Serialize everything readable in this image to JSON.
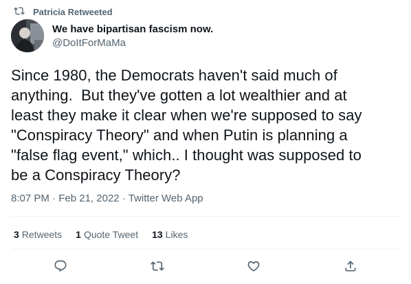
{
  "retweet_notice": {
    "text": "Patricia Retweeted",
    "icon": "retweet-icon"
  },
  "author": {
    "display_name": "We have bipartisan fascism now.",
    "handle": "@DoItForMaMa",
    "avatar": "avatar-photo"
  },
  "tweet": {
    "text": "Since 1980, the Democrats haven't said much of\nanything.  But they've gotten a lot wealthier and at\nleast they make it clear when we're supposed to say\n\"Conspiracy Theory\" and when Putin is planning a\n\"false flag event,\" which.. I thought was supposed to\nbe a Conspiracy Theory?",
    "time": "8:07 PM",
    "date": "Feb 21, 2022",
    "source": "Twitter Web App",
    "separator": "·"
  },
  "stats": {
    "retweets_count": "3",
    "retweets_label": "Retweets",
    "quotes_count": "1",
    "quotes_label": "Quote Tweet",
    "likes_count": "13",
    "likes_label": "Likes"
  },
  "actions": [
    "reply-icon",
    "retweet-icon",
    "like-icon",
    "share-icon"
  ],
  "colors": {
    "text": "#0f1419",
    "secondary": "#536471",
    "divider": "#eff3f4"
  }
}
